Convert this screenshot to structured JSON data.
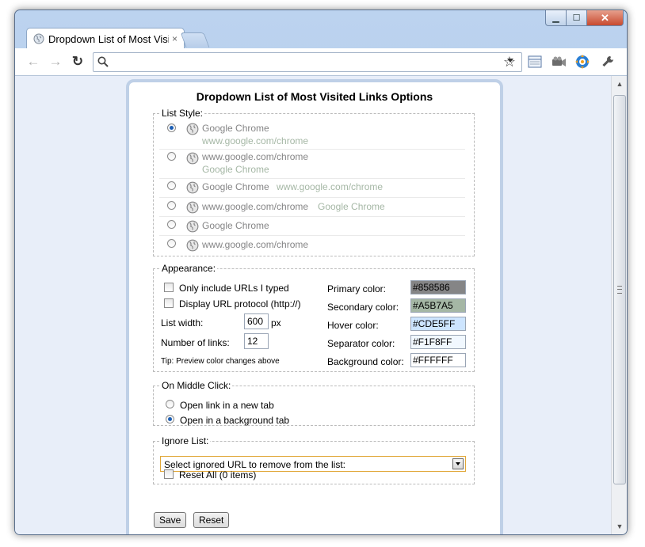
{
  "window": {
    "tab_title": "Dropdown List of Most Visited Links Options",
    "tab_close": "×",
    "controls": {
      "minimize": "▁",
      "maximize": "☐",
      "close": "✕"
    }
  },
  "toolbar": {
    "back": "←",
    "forward": "→",
    "reload": "↻",
    "omnibox_value": "",
    "star": "☆",
    "icons": [
      "page-action-icon",
      "extension-camera-icon",
      "extension-blue-gear-icon",
      "wrench-icon"
    ]
  },
  "page": {
    "title": "Dropdown List of Most Visited Links Options",
    "list_style": {
      "legend": "List Style:",
      "options": [
        {
          "primary": "Google Chrome",
          "secondary": "www.google.com/chrome",
          "checked": true
        },
        {
          "primary": "www.google.com/chrome",
          "secondary": "Google Chrome",
          "checked": false
        },
        {
          "primary": "Google Chrome",
          "secondary": "www.google.com/chrome",
          "checked": false
        },
        {
          "primary": "www.google.com/chrome",
          "secondary": "Google Chrome",
          "checked": false
        },
        {
          "primary": "Google Chrome",
          "secondary": "",
          "checked": false
        },
        {
          "primary": "www.google.com/chrome",
          "secondary": "",
          "checked": false
        }
      ]
    },
    "appearance": {
      "legend": "Appearance:",
      "only_typed": "Only include URLs I typed",
      "display_protocol": "Display URL protocol (http://)",
      "list_width_label": "List width:",
      "list_width_value": "600",
      "list_width_unit": "px",
      "num_links_label": "Number of links:",
      "num_links_value": "12",
      "tip": "Tip: Preview color changes above",
      "colors": [
        {
          "label": "Primary color:",
          "value": "#858586",
          "bg": "#858586"
        },
        {
          "label": "Secondary color:",
          "value": "#A5B7A5",
          "bg": "#A5B7A5"
        },
        {
          "label": "Hover color:",
          "value": "#CDE5FF",
          "bg": "#CDE5FF"
        },
        {
          "label": "Separator color:",
          "value": "#F1F8FF",
          "bg": "#F1F8FF"
        },
        {
          "label": "Background color:",
          "value": "#FFFFFF",
          "bg": "#FFFFFF"
        }
      ]
    },
    "middle_click": {
      "legend": "On Middle Click:",
      "options": [
        {
          "label": "Open link in a new tab",
          "checked": false
        },
        {
          "label": "Open in a background tab",
          "checked": true
        }
      ]
    },
    "ignore_list": {
      "legend": "Ignore List:",
      "select_value": "Select ignored URL to remove from the list:",
      "reset_all": "Reset All (0 items)"
    },
    "buttons": {
      "save": "Save",
      "reset": "Reset"
    }
  }
}
